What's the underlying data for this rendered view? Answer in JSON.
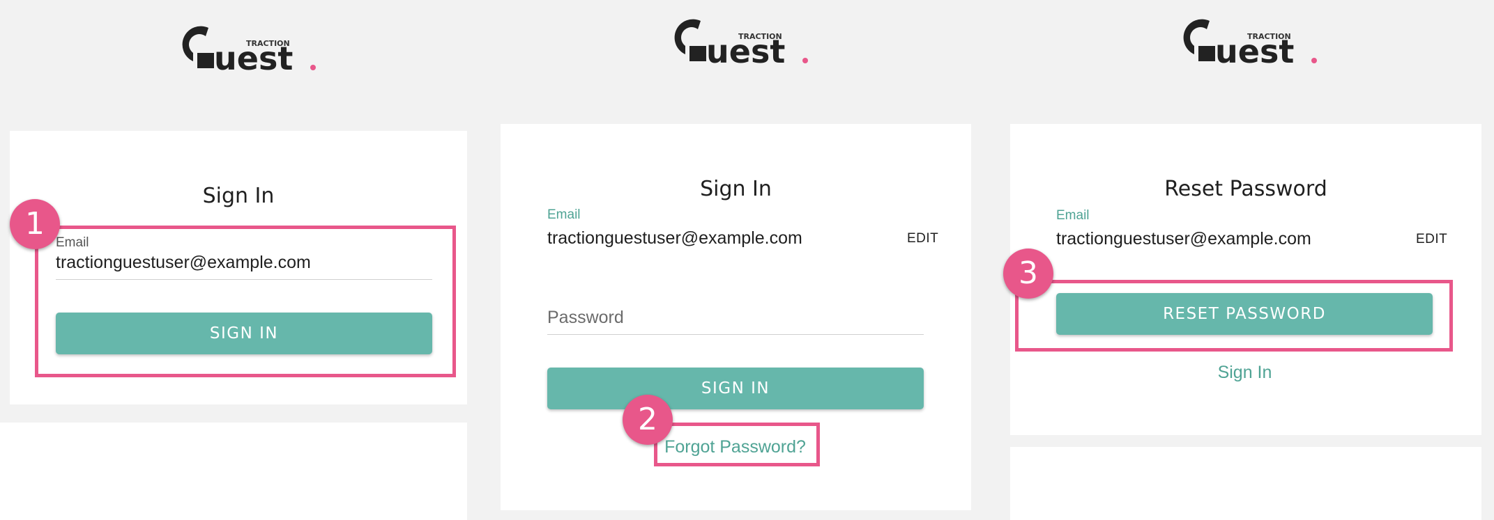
{
  "colors": {
    "accent": "#66b7ab",
    "link": "#4fa394",
    "annotation": "#e8578a",
    "background": "#f2f2f2"
  },
  "logo": {
    "small_text": "TRACTION",
    "big_text": "uest"
  },
  "panel1": {
    "title": "Sign In",
    "email_label": "Email",
    "email_value": "tractionguestuser@example.com",
    "button_label": "SIGN IN",
    "badge": "1"
  },
  "panel2": {
    "title": "Sign In",
    "email_label": "Email",
    "email_value": "tractionguestuser@example.com",
    "edit_label": "EDIT",
    "password_placeholder": "Password",
    "button_label": "SIGN IN",
    "forgot_link": "Forgot Password?",
    "badge": "2"
  },
  "panel3": {
    "title": "Reset Password",
    "email_label": "Email",
    "email_value": "tractionguestuser@example.com",
    "edit_label": "EDIT",
    "button_label": "RESET PASSWORD",
    "signin_link": "Sign In",
    "badge": "3"
  }
}
